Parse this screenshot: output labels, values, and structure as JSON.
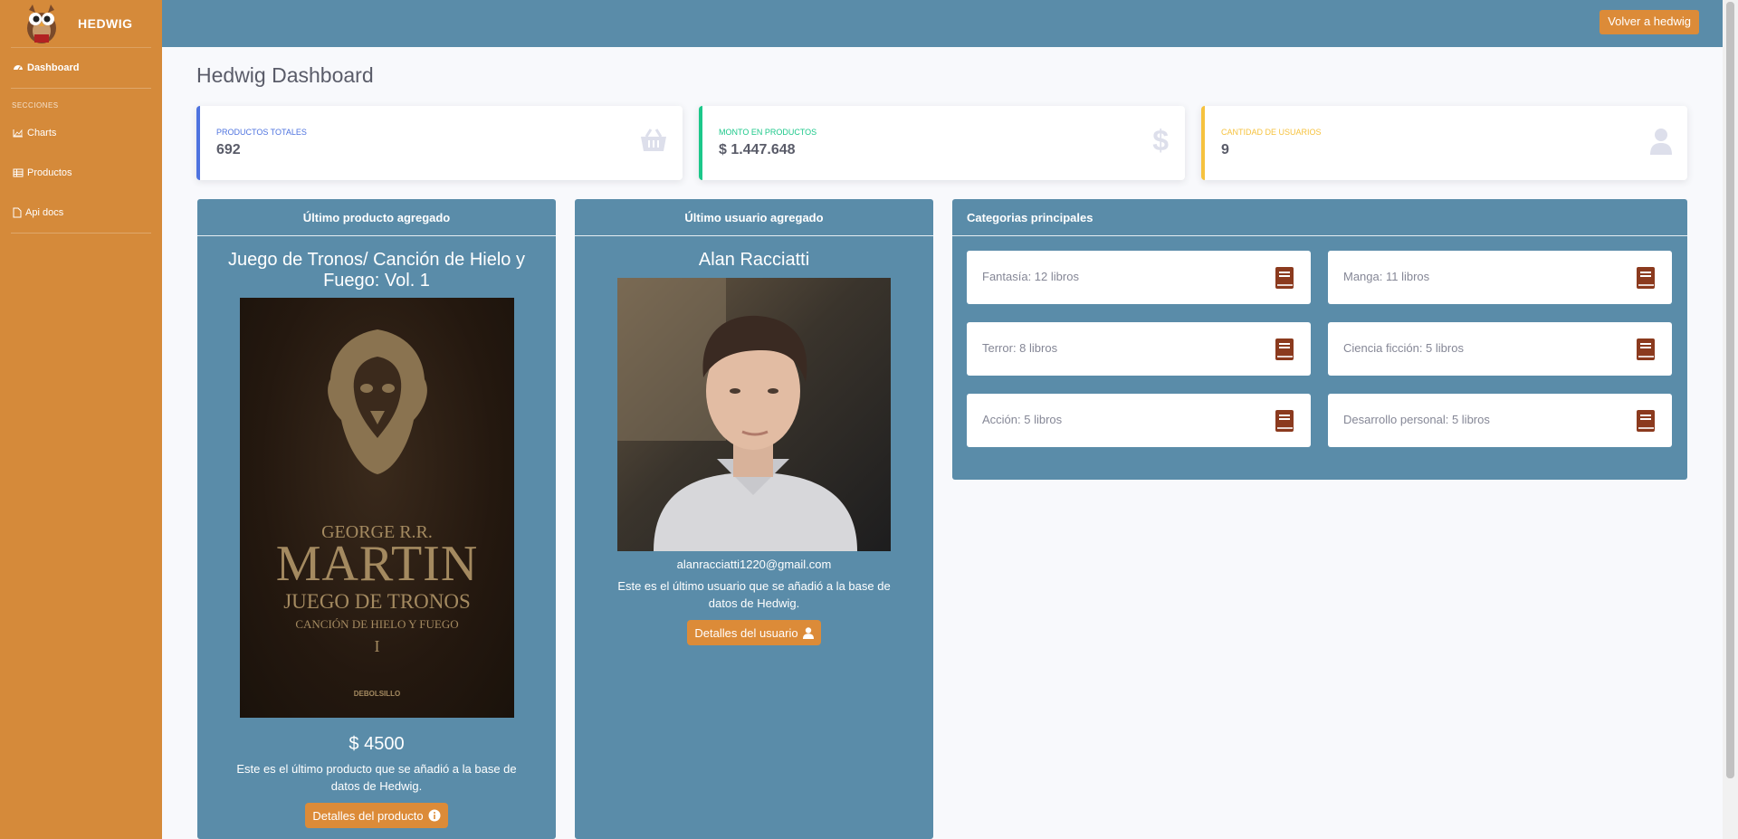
{
  "brand": {
    "name": "HEDWIG"
  },
  "sidebar": {
    "dashboard_label": "Dashboard",
    "section_heading": "SECCIONES",
    "items": [
      {
        "label": "Charts",
        "icon": "chart-area-icon"
      },
      {
        "label": "Productos",
        "icon": "table-icon"
      },
      {
        "label": "Api docs",
        "icon": "file-icon"
      }
    ]
  },
  "topbar": {
    "back_label": "Volver a hedwig"
  },
  "page": {
    "title": "Hedwig Dashboard"
  },
  "stats": [
    {
      "label": "Productos totales",
      "value": "692",
      "icon": "shopping-basket-icon",
      "color": "#4e73df"
    },
    {
      "label": "Monto en productos",
      "value": "$ 1.447.648",
      "icon": "dollar-icon",
      "color": "#1cc88a"
    },
    {
      "label": "Cantidad de usuarios",
      "value": "9",
      "icon": "user-icon",
      "color": "#f6c23e"
    }
  ],
  "last_product": {
    "header": "Último producto agregado",
    "title": "Juego de Tronos/ Canción de Hielo y Fuego: Vol. 1",
    "cover": {
      "author_small": "GEORGE R.R.",
      "author": "MARTIN",
      "book_title": "JUEGO DE TRONOS",
      "subtitle": "CANCIÓN DE HIELO Y FUEGO",
      "volume": "I",
      "publisher": "DEBOLSILLO"
    },
    "price": "$ 4500",
    "description": "Este es el último producto que se añadió a la base de datos de Hedwig.",
    "button_label": "Detalles del producto"
  },
  "last_user": {
    "header": "Último usuario agregado",
    "name": "Alan Racciatti",
    "email": "alanracciatti1220@gmail.com",
    "description": "Este es el último usuario que se añadió a la base de datos de Hedwig.",
    "button_label": "Detalles del usuario"
  },
  "categories": {
    "header": "Categorias principales",
    "items": [
      {
        "label": "Fantasía: 12 libros"
      },
      {
        "label": "Manga: 11 libros"
      },
      {
        "label": "Terror: 8 libros"
      },
      {
        "label": "Ciencia ficción: 5 libros"
      },
      {
        "label": "Acción: 5 libros"
      },
      {
        "label": "Desarrollo personal: 5 libros"
      }
    ],
    "icon_color": "#8b3a1e"
  }
}
